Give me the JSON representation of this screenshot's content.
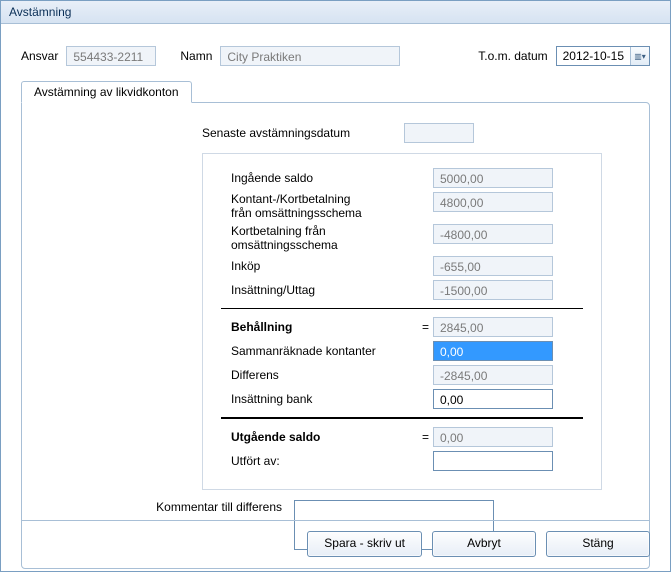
{
  "window": {
    "title": "Avstämning"
  },
  "header": {
    "ansvar_label": "Ansvar",
    "ansvar_value": "554433-2211",
    "namn_label": "Namn",
    "namn_value": "City Praktiken",
    "tom_label": "T.o.m. datum",
    "tom_value": "2012-10-15"
  },
  "tab": {
    "label": "Avstämning av likvidkonton"
  },
  "panel": {
    "senaste_label": "Senaste avstämningsdatum",
    "senaste_value": "",
    "ingaende_label": "Ingående saldo",
    "ingaende_value": "5000,00",
    "kontant_label_1": "Kontant-/Kortbetalning",
    "kontant_label_2": "från omsättningsschema",
    "kontant_value": "4800,00",
    "kortbet_label_1": "Kortbetalning från",
    "kortbet_label_2": "omsättningsschema",
    "kortbet_value": "-4800,00",
    "inkop_label": "Inköp",
    "inkop_value": "-655,00",
    "insut_label": "Insättning/Uttag",
    "insut_value": "-1500,00",
    "behall_label": "Behållning",
    "behall_value": "2845,00",
    "samman_label": "Sammanräknade kontanter",
    "samman_value": "0,00",
    "diff_label": "Differens",
    "diff_value": "-2845,00",
    "bank_label": "Insättning bank",
    "bank_value": "0,00",
    "utga_label": "Utgående saldo",
    "utga_value": "0,00",
    "utfort_label": "Utfört av:",
    "utfort_value": "",
    "eq": "="
  },
  "comment": {
    "label": "Kommentar till differens",
    "value": ""
  },
  "footer": {
    "save": "Spara - skriv ut",
    "cancel": "Avbryt",
    "close": "Stäng"
  }
}
